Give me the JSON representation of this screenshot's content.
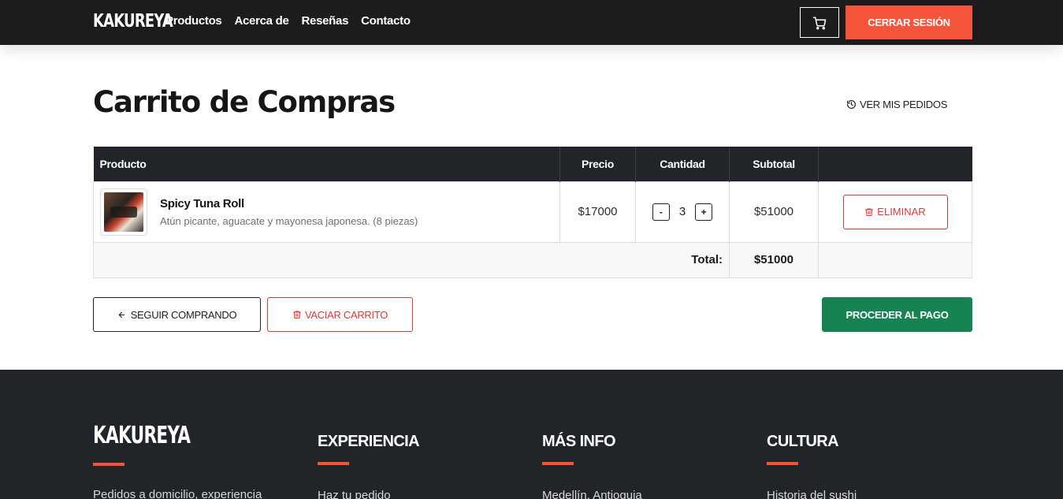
{
  "nav": {
    "logo": "KAKUREYA",
    "links": [
      "Productos",
      "Acerca de",
      "Reseñas",
      "Contacto"
    ],
    "logout_label": "CERRAR SESIÓN",
    "cart_icon": "cart-icon"
  },
  "page": {
    "title": "Carrito de Compras",
    "orders_link": "VER MIS PEDIDOS"
  },
  "table": {
    "headers": [
      "Producto",
      "Precio",
      "Cantidad",
      "Subtotal",
      ""
    ],
    "items": [
      {
        "name": "Spicy Tuna Roll",
        "description": "Atún picante, aguacate y mayonesa japonesa. (8 piezas)",
        "price": "$17000",
        "quantity": "3",
        "subtotal": "$51000",
        "decrease": "-",
        "increase": "+",
        "delete_label": "ELIMINAR"
      }
    ],
    "total_label": "Total:",
    "total_value": "$51000"
  },
  "actions": {
    "continue_label": "SEGUIR COMPRANDO",
    "empty_label": "VACIAR CARRITO",
    "pay_label": "PROCEDER AL PAGO"
  },
  "footer": {
    "logo": "KAKUREYA",
    "tagline": "Pedidos a domicilio, experiencia",
    "columns": [
      {
        "heading": "EXPERIENCIA",
        "first_item": "Haz tu pedido"
      },
      {
        "heading": "MÁS INFO",
        "first_item": "Medellín, Antioquia"
      },
      {
        "heading": "CULTURA",
        "first_item": "Historia del sushi"
      }
    ]
  },
  "colors": {
    "dark": "#1c1c1e",
    "accent": "#f4553a",
    "danger": "#d23c3c",
    "success": "#188352"
  }
}
